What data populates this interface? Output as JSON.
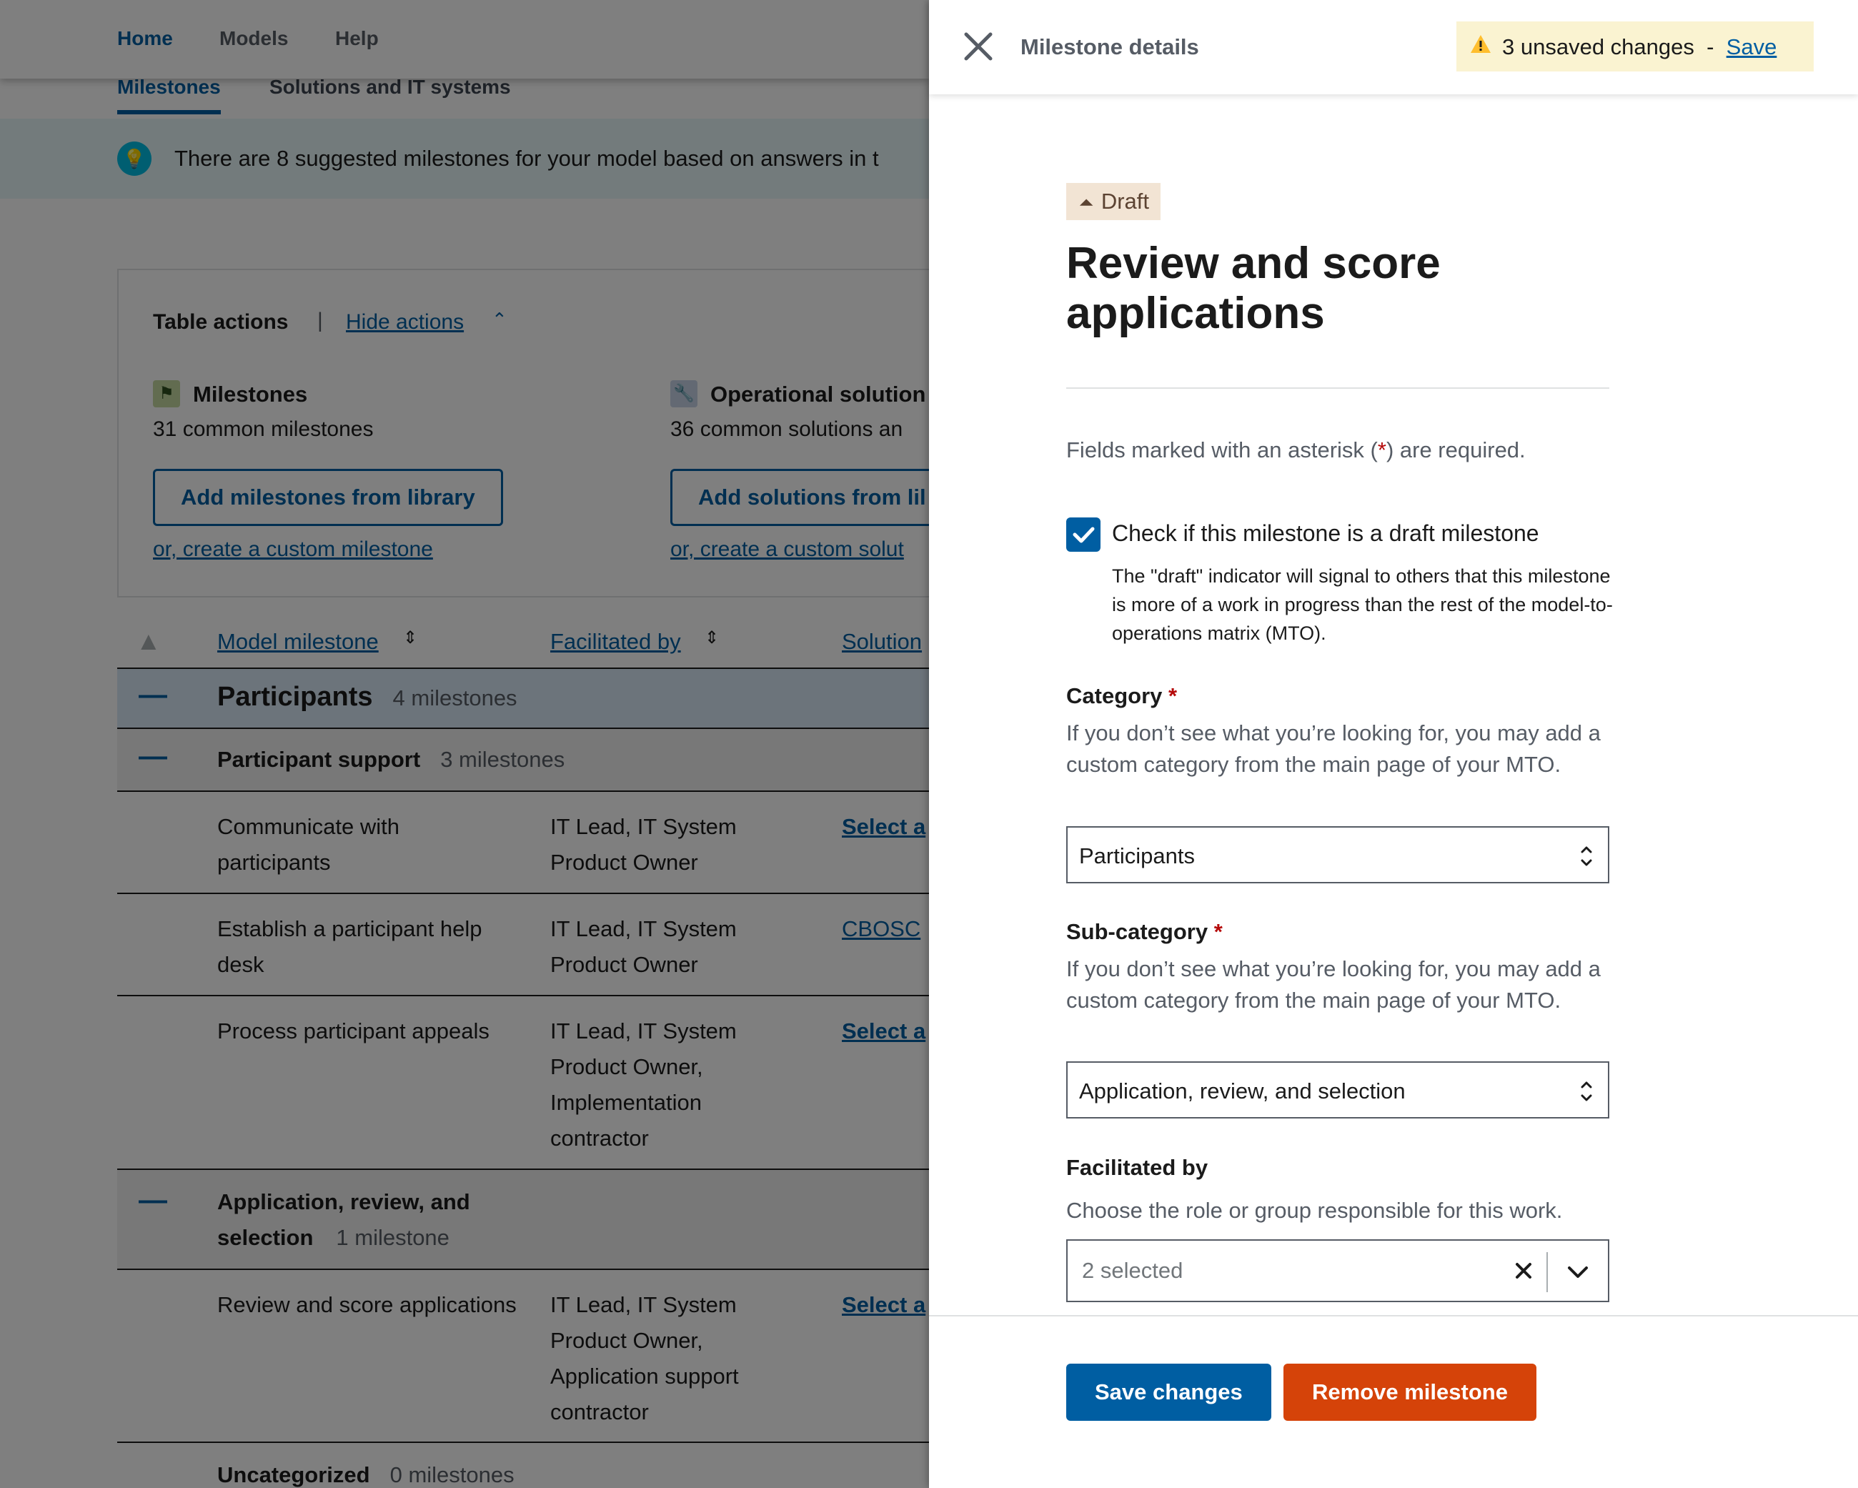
{
  "nav": {
    "items": [
      "Home",
      "Models",
      "Help"
    ],
    "subtabs": [
      "Milestones",
      "Solutions and IT systems"
    ]
  },
  "alert": {
    "text": "There are 8 suggested milestones for your model based on answers in t",
    "icon": "lightbulb-icon"
  },
  "table_actions": {
    "title": "Table actions",
    "separator": "|",
    "hide_label": "Hide actions",
    "milestones": {
      "title": "Milestones",
      "subtitle": "31 common milestones",
      "button": "Add milestones from library",
      "link": "or, create a custom milestone",
      "icon": "flag-icon"
    },
    "solutions": {
      "title": "Operational solution",
      "subtitle": "36 common solutions an",
      "button": "Add solutions from lil",
      "link": "or, create a custom solut",
      "icon": "wrench-icon"
    }
  },
  "table": {
    "headers": [
      "Model milestone",
      "Facilitated by",
      "Solution"
    ],
    "groups": [
      {
        "title": "Participants",
        "count": "4 milestones"
      }
    ],
    "subgroups": [
      {
        "title": "Participant support",
        "count": "3 milestones"
      },
      {
        "title_line1": "Application, review, and",
        "title_line2": "selection",
        "count": "1 milestone"
      },
      {
        "title": "Uncategorized",
        "count": "0 milestones"
      }
    ],
    "rows": [
      {
        "milestone": [
          "Communicate with",
          "participants"
        ],
        "facilitated": [
          "IT Lead, IT System",
          "Product Owner"
        ],
        "solution": "Select a"
      },
      {
        "milestone": [
          "Establish a participant help",
          "desk"
        ],
        "facilitated": [
          "IT Lead, IT System",
          "Product Owner"
        ],
        "solution": "CBOSC"
      },
      {
        "milestone": [
          "Process participant appeals"
        ],
        "facilitated": [
          "IT Lead, IT System",
          "Product Owner,",
          "Implementation",
          "contractor"
        ],
        "solution": "Select a"
      },
      {
        "milestone": [
          "Review and score applications"
        ],
        "facilitated": [
          "IT Lead, IT System",
          "Product Owner,",
          "Application support",
          "contractor"
        ],
        "solution": "Select a"
      }
    ]
  },
  "panel": {
    "title": "Milestone details",
    "unsaved": {
      "text": "3 unsaved changes",
      "separator": "-",
      "save": "Save"
    },
    "badge": "Draft",
    "heading": "Review and score applications",
    "required_note": {
      "before": "Fields marked with an asterisk (",
      "star": "*",
      "after": ") are required."
    },
    "draft_checkbox": {
      "label": "Check if this milestone is a draft milestone",
      "checked": true,
      "hint": "The \"draft\" indicator will signal to others that this milestone is more of a work in progress than the rest of the model-to-operations matrix (MTO)."
    },
    "category": {
      "label": "Category",
      "star": "*",
      "hint": "If you don’t see what you’re looking for, you may add a custom category from the main page of your MTO.",
      "value": "Participants"
    },
    "subcategory": {
      "label": "Sub-category",
      "star": "*",
      "hint": "If you don’t see what you’re looking for, you may add a custom category from the main page of your MTO.",
      "value": "Application, review, and selection"
    },
    "facilitated_by": {
      "label": "Facilitated by",
      "hint": "Choose the role or group responsible for this work.",
      "value": "2 selected"
    },
    "buttons": {
      "save": "Save changes",
      "remove": "Remove milestone"
    }
  },
  "colors": {
    "primary": "#005ea2",
    "danger": "#d54309",
    "warning_bg": "#faf3d1",
    "draft_bg": "#f2e4d4"
  }
}
